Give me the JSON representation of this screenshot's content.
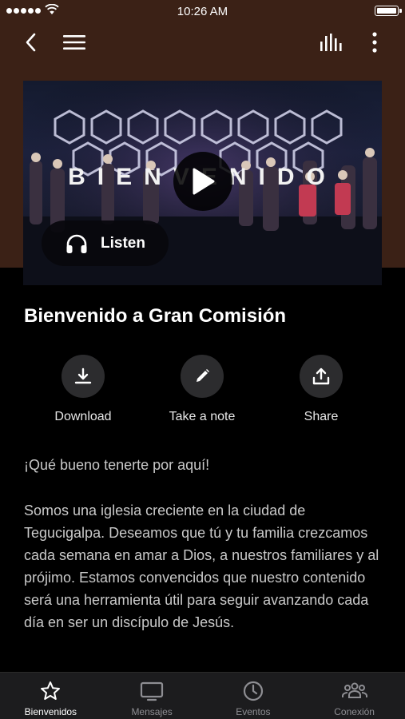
{
  "status_bar": {
    "time": "10:26 AM"
  },
  "video": {
    "overlay_text": "BIENVENIDO",
    "listen_label": "Listen"
  },
  "page_title": "Bienvenido a Gran Comisión",
  "actions": [
    {
      "label": "Download",
      "icon": "download-icon"
    },
    {
      "label": "Take a note",
      "icon": "pencil-icon"
    },
    {
      "label": "Share",
      "icon": "share-icon"
    }
  ],
  "body": {
    "greeting": "¡Qué bueno tenerte por aquí!",
    "paragraph": "Somos una iglesia creciente en la ciudad de Tegucigalpa. Deseamos que tú y tu familia crezcamos cada semana en amar a Dios, a nuestros familiares y al prójimo. Estamos convencidos que nuestro contenido será una herramienta útil para seguir avanzando cada día en ser un discípulo de Jesús."
  },
  "tabs": [
    {
      "label": "Bienvenidos",
      "icon": "star-icon",
      "active": true
    },
    {
      "label": "Mensajes",
      "icon": "tv-icon",
      "active": false
    },
    {
      "label": "Eventos",
      "icon": "clock-icon",
      "active": false
    },
    {
      "label": "Conexión",
      "icon": "people-icon",
      "active": false
    }
  ],
  "colors": {
    "header_brown": "#3b2116",
    "background": "#000000",
    "tabbar": "#1c1c1e",
    "action_circle": "#2c2c2e",
    "body_text": "#c9c9c9",
    "inactive_tab": "#8e8e93"
  }
}
